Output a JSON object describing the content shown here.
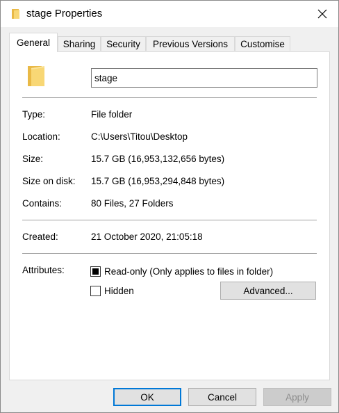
{
  "window": {
    "title": "stage Properties"
  },
  "tabs": [
    {
      "label": "General",
      "active": true
    },
    {
      "label": "Sharing",
      "active": false
    },
    {
      "label": "Security",
      "active": false
    },
    {
      "label": "Previous Versions",
      "active": false
    },
    {
      "label": "Customise",
      "active": false
    }
  ],
  "general": {
    "name_value": "stage",
    "type": {
      "label": "Type:",
      "value": "File folder"
    },
    "location": {
      "label": "Location:",
      "value": "C:\\Users\\Titou\\Desktop"
    },
    "size": {
      "label": "Size:",
      "value": "15.7 GB (16,953,132,656 bytes)"
    },
    "size_on_disk": {
      "label": "Size on disk:",
      "value": "15.7 GB (16,953,294,848 bytes)"
    },
    "contains": {
      "label": "Contains:",
      "value": "80 Files, 27 Folders"
    },
    "created": {
      "label": "Created:",
      "value": "21 October 2020, 21:05:18"
    },
    "attributes": {
      "label": "Attributes:",
      "readonly": {
        "label": "Read-only (Only applies to files in folder)",
        "state": "indeterminate"
      },
      "hidden": {
        "label": "Hidden",
        "state": "unchecked"
      },
      "advanced_button": "Advanced..."
    }
  },
  "buttons": {
    "ok": "OK",
    "cancel": "Cancel",
    "apply": "Apply"
  },
  "colors": {
    "accent": "#0078d7",
    "folder_yellow": "#f8d775",
    "folder_dark": "#e9b946"
  },
  "icons": {
    "title": "folder-icon",
    "close": "close-icon",
    "large": "folder-large-icon"
  }
}
